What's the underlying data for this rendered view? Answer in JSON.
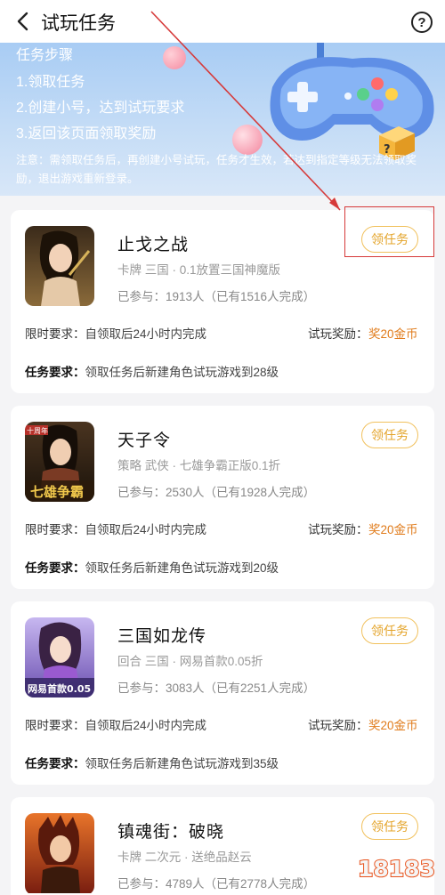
{
  "header": {
    "back_icon": "chevron-left-icon",
    "title": "试玩任务",
    "help_icon": "question-circle-icon",
    "help_label": "?"
  },
  "banner": {
    "steps_title": "任务步骤",
    "steps": [
      "1.领取任务",
      "2.创建小号，达到试玩要求",
      "3.返回该页面领取奖励"
    ],
    "notice": "注意：需领取任务后，再创建小号试玩，任务才生效，若达到指定等级无法领取奖励，退出游戏重新登录。",
    "bg_color": "#b7d3f5"
  },
  "tasks": [
    {
      "name": "止戈之战",
      "tags": "卡牌  三国 · 0.1放置三国神魔版",
      "participants": "已参与：1913人（已有1516人完成）",
      "claim": "领任务",
      "time_label": "限时要求：",
      "time_value": "自领取后24小时内完成",
      "reward_label": "试玩奖励：",
      "reward_value": "奖20金币",
      "task_label": "任务要求：",
      "task_value": "领取任务后新建角色试玩游戏到28级"
    },
    {
      "name": "天子令",
      "tags": "策略  武侠 · 七雄争霸正版0.1折",
      "participants": "已参与：2530人（已有1928人完成）",
      "claim": "领任务",
      "icon_text": "七雄争霸",
      "badge": "十周年",
      "time_label": "限时要求：",
      "time_value": "自领取后24小时内完成",
      "reward_label": "试玩奖励：",
      "reward_value": "奖20金币",
      "task_label": "任务要求：",
      "task_value": "领取任务后新建角色试玩游戏到20级"
    },
    {
      "name": "三国如龙传",
      "tags": "回合  三国 · 网易首款0.05折",
      "participants": "已参与：3083人（已有2251人完成）",
      "claim": "领任务",
      "icon_text": "网易首款0.05",
      "time_label": "限时要求：",
      "time_value": "自领取后24小时内完成",
      "reward_label": "试玩奖励：",
      "reward_value": "奖20金币",
      "task_label": "任务要求：",
      "task_value": "领取任务后新建角色试玩游戏到35级"
    },
    {
      "name": "镇魂街：破晓",
      "tags": "卡牌  二次元 · 送绝品赵云",
      "participants": "已参与：4789人（已有2778人完成）",
      "claim": "领任务"
    }
  ],
  "watermark": "18183",
  "colors": {
    "accent": "#e4a42a",
    "reward": "#e07b1b",
    "annotation": "#d63a3a"
  }
}
